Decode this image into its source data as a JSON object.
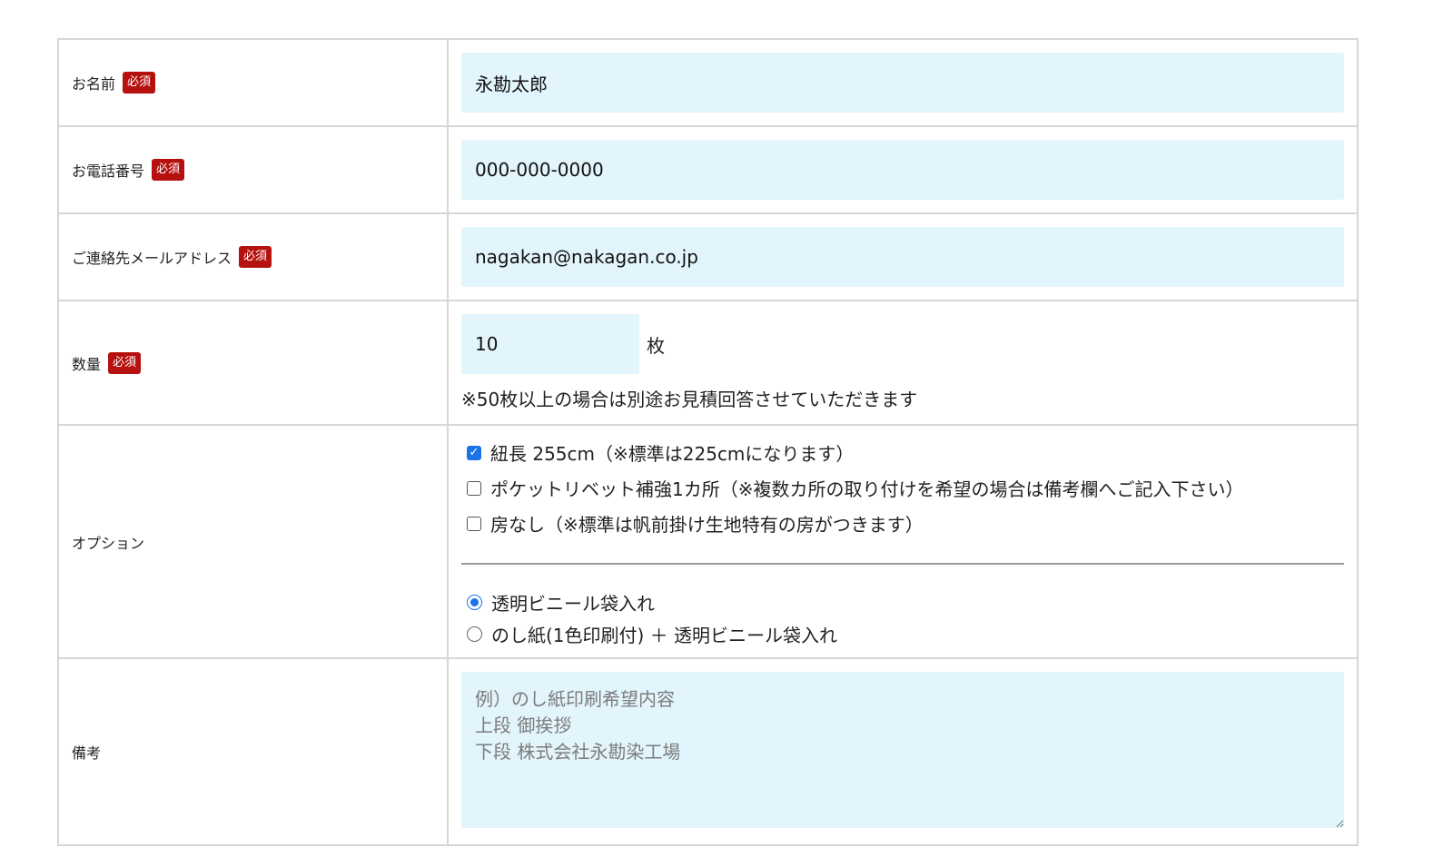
{
  "required_badge": "必須",
  "fields": {
    "name": {
      "label": "お名前",
      "value": "永勘太郎"
    },
    "phone": {
      "label": "お電話番号",
      "value": "000-000-0000"
    },
    "email": {
      "label": "ご連絡先メールアドレス",
      "value": "nagakan@nakagan.co.jp"
    },
    "quantity": {
      "label": "数量",
      "value": "10",
      "unit": "枚",
      "note": "※50枚以上の場合は別途お見積回答させていただきます"
    },
    "options": {
      "label": "オプション",
      "checkboxes": [
        {
          "label": "紐長 255cm（※標準は225cmになります）",
          "checked": true
        },
        {
          "label": "ポケットリベット補強1カ所（※複数カ所の取り付けを希望の場合は備考欄へご記入下さい）",
          "checked": false
        },
        {
          "label": "房なし（※標準は帆前掛け生地特有の房がつきます）",
          "checked": false
        }
      ],
      "radios": [
        {
          "label": "透明ビニール袋入れ",
          "selected": true
        },
        {
          "label": "のし紙(1色印刷付) ＋ 透明ビニール袋入れ",
          "selected": false
        }
      ]
    },
    "remarks": {
      "label": "備考",
      "placeholder": "例）のし紙印刷希望内容\n上段 御挨拶\n下段 株式会社永勘染工場"
    }
  }
}
